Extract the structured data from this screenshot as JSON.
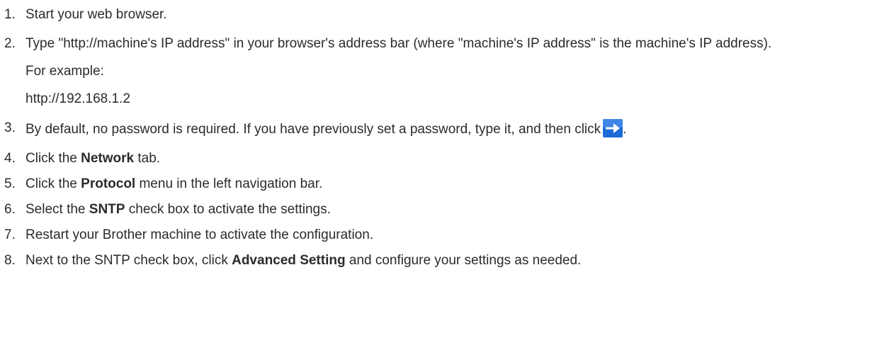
{
  "steps": [
    {
      "num": "1.",
      "text": "Start your web browser."
    },
    {
      "num": "2.",
      "text": "Type \"http://machine's IP address\" in your browser's address bar (where \"machine's IP address\" is the machine's IP address).",
      "example_label": "For example:",
      "example_url": "http://192.168.1.2"
    },
    {
      "num": "3.",
      "text": "By default, no password is required. If you have previously set a password, type it, and then click",
      "end": "."
    },
    {
      "num": "4.",
      "pre": "Click the ",
      "bold": "Network",
      "post": " tab."
    },
    {
      "num": "5.",
      "pre": "Click the ",
      "bold": "Protocol",
      "post": " menu in the left navigation bar."
    },
    {
      "num": "6.",
      "pre": "Select the ",
      "bold": "SNTP",
      "post": " check box to activate the settings."
    },
    {
      "num": "7.",
      "text": "Restart your Brother machine to activate the configuration."
    },
    {
      "num": "8.",
      "pre": "Next to the SNTP check box, click ",
      "bold": "Advanced Setting",
      "post": " and configure your settings as needed."
    }
  ],
  "icons": {
    "login_arrow": "right-arrow-icon"
  },
  "colors": {
    "text": "#2b2b2b",
    "arrow_bg": "#1c6ad6",
    "arrow_fg": "#ffffff"
  }
}
